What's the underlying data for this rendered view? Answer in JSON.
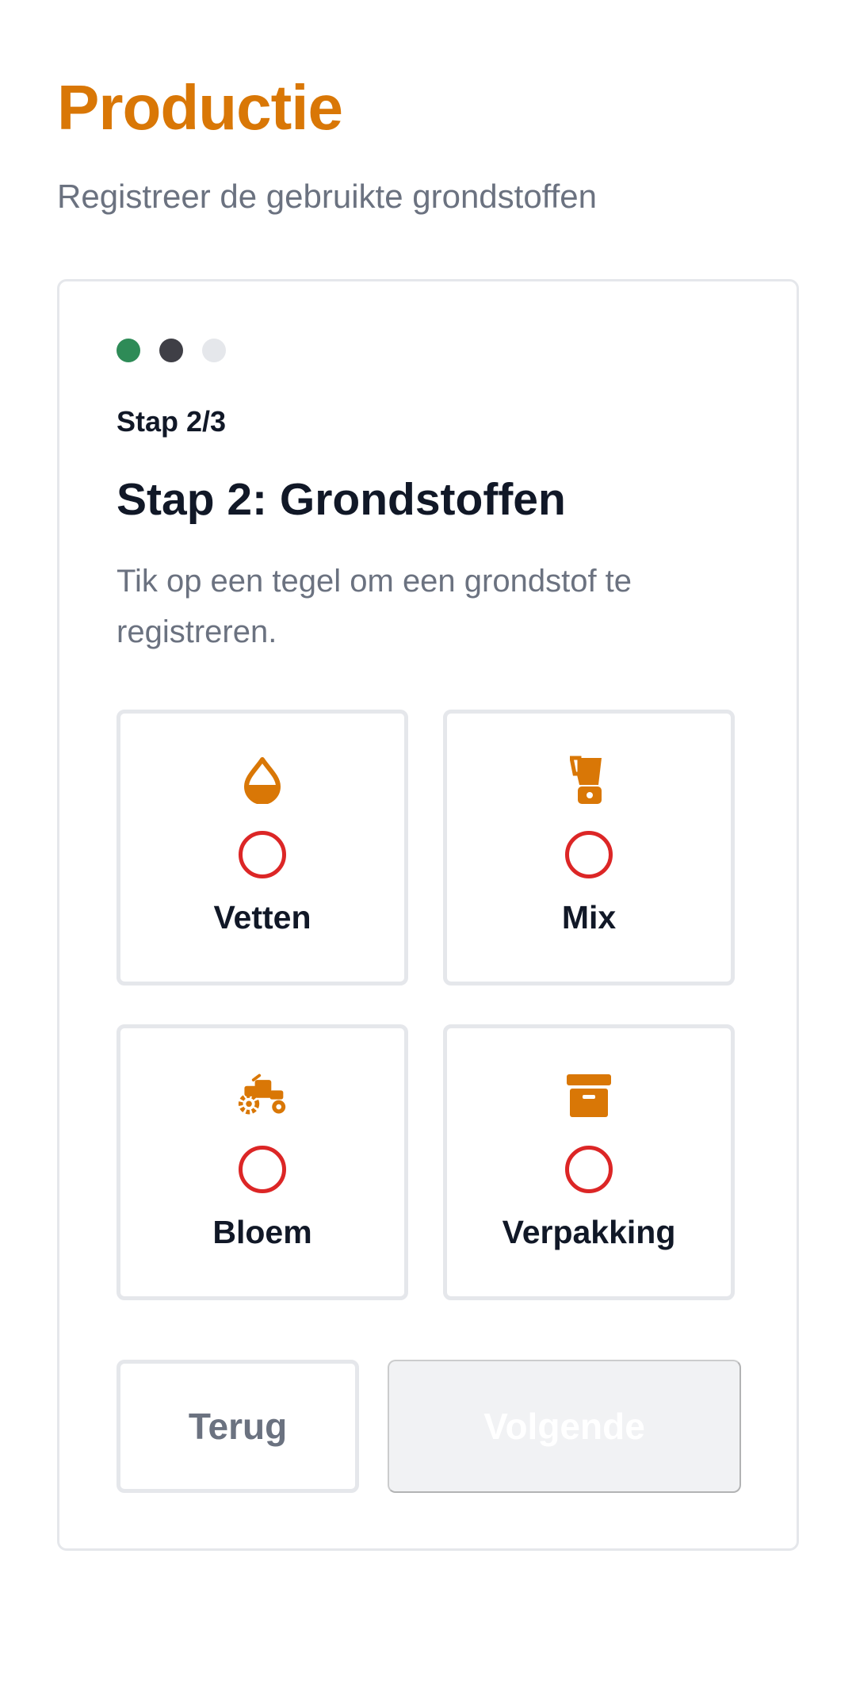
{
  "header": {
    "title": "Productie",
    "subtitle": "Registreer de gebruikte grondstoffen"
  },
  "wizard": {
    "step_counter": "Stap 2/3",
    "step_title": "Stap 2: Grondstoffen",
    "step_description": "Tik op een tegel om een grondstof te registreren.",
    "steps": [
      {
        "state": "completed",
        "color": "#2e8b57"
      },
      {
        "state": "current",
        "color": "#3f3f46"
      },
      {
        "state": "upcoming",
        "color": "#e5e7eb"
      }
    ]
  },
  "tiles": [
    {
      "label": "Vetten",
      "icon": "droplet-half-icon",
      "registered": false
    },
    {
      "label": "Mix",
      "icon": "blender-icon",
      "registered": false
    },
    {
      "label": "Bloem",
      "icon": "tractor-icon",
      "registered": false
    },
    {
      "label": "Verpakking",
      "icon": "archive-box-icon",
      "registered": false
    }
  ],
  "actions": {
    "back_label": "Terug",
    "next_label": "Volgende",
    "next_enabled": false
  },
  "colors": {
    "accent": "#d97706",
    "status_unregistered": "#dc2626",
    "step_done": "#2e8b57",
    "step_current": "#3f3f46",
    "step_upcoming": "#e5e7eb"
  }
}
